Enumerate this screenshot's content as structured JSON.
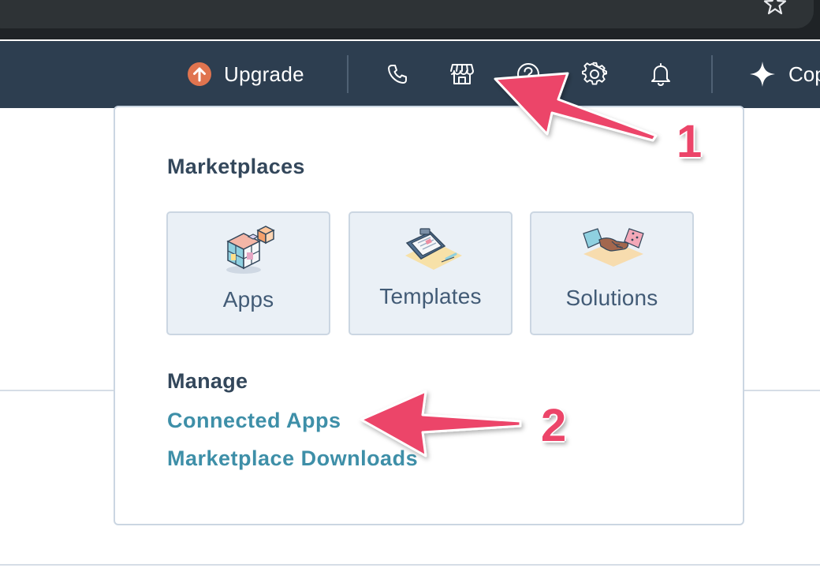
{
  "nav": {
    "upgrade_label": "Upgrade",
    "copilot_label": "Copilot",
    "icons": [
      "phone-icon",
      "marketplace-icon",
      "help-icon",
      "settings-icon",
      "notifications-icon",
      "sparkle-icon"
    ]
  },
  "dropdown": {
    "marketplaces_title": "Marketplaces",
    "tiles": [
      {
        "label": "Apps",
        "icon": "apps-illustration"
      },
      {
        "label": "Templates",
        "icon": "templates-illustration"
      },
      {
        "label": "Solutions",
        "icon": "solutions-illustration"
      }
    ],
    "manage_title": "Manage",
    "links": [
      {
        "label": "Connected Apps"
      },
      {
        "label": "Marketplace Downloads"
      }
    ]
  },
  "annotations": {
    "callouts": [
      "1",
      "2"
    ],
    "color": "#ec4569"
  },
  "colors": {
    "nav_background": "#2d3e50",
    "upgrade_badge": "#e0744f",
    "link_color": "#3e8fa8",
    "heading_color": "#33475b",
    "tile_background": "#eaf0f6"
  }
}
